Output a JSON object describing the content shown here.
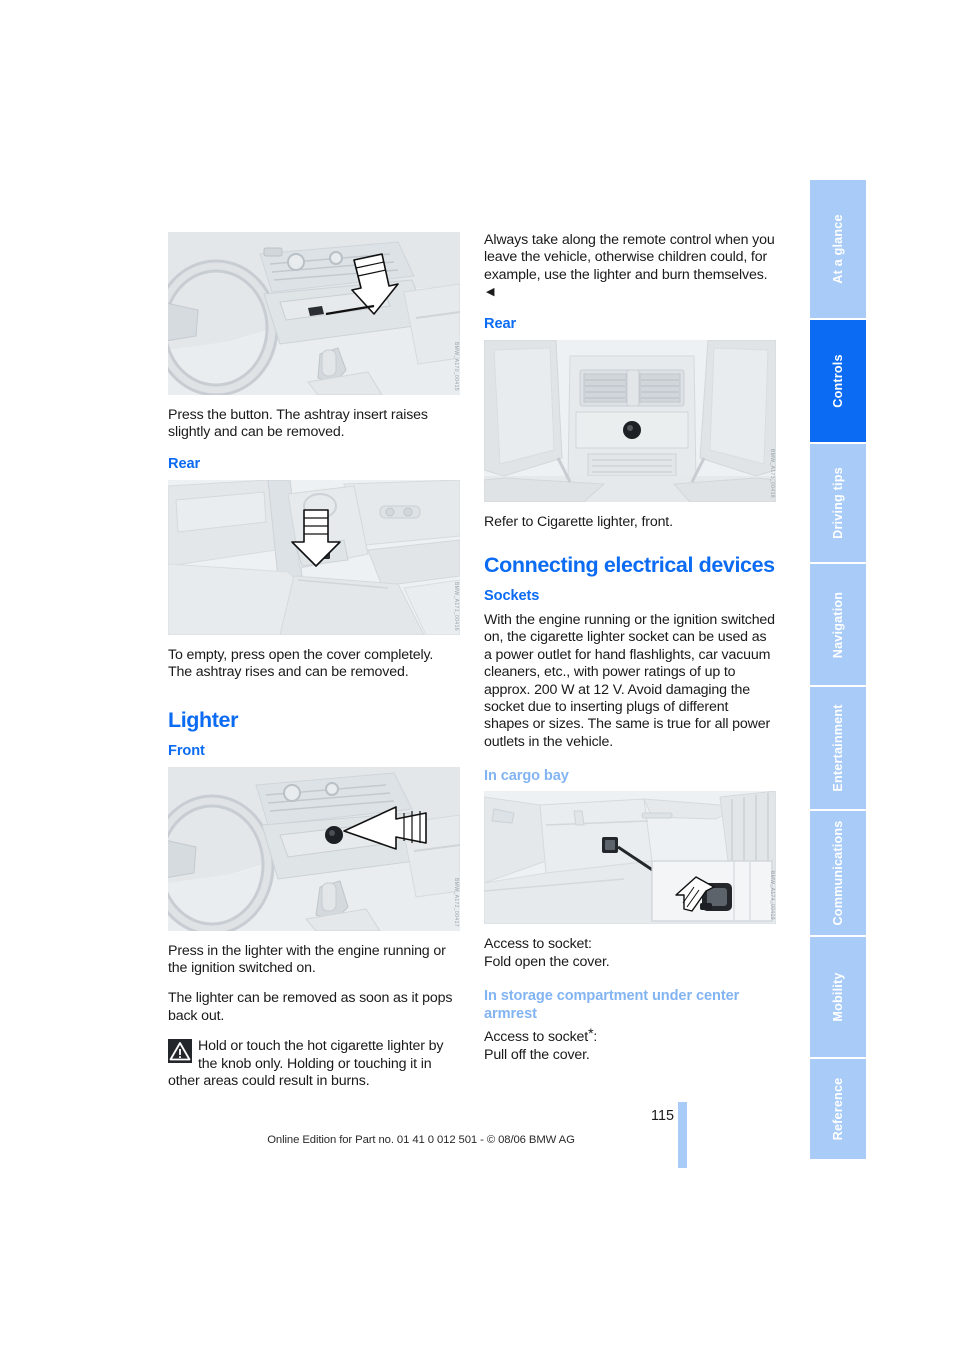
{
  "page": {
    "number": "115",
    "footer": "Online Edition for Part no. 01 41 0 012 501 - © 08/06 BMW AG"
  },
  "left_column": {
    "figure_ashtray_front": {
      "name": "front-ashtray-illustration",
      "code": "BMW_A170_00415"
    },
    "para_press_button": "Press the button. The ashtray insert raises slightly and can be removed.",
    "heading_rear": "Rear",
    "figure_ashtray_rear": {
      "name": "rear-ashtray-illustration",
      "code": "BMW_A171_00416"
    },
    "para_to_empty": "To empty, press open the cover completely. The ashtray rises and can be removed.",
    "heading_lighter": "Lighter",
    "heading_front": "Front",
    "figure_lighter_front": {
      "name": "front-lighter-illustration",
      "code": "BMW_A172_00417"
    },
    "para_press_in": "Press in the lighter with the engine running or the ignition switched on.",
    "para_pops_out": "The lighter can be removed as soon as it pops back out.",
    "warning": "Hold or touch the hot cigarette lighter by the knob only. Holding or touching it in other areas could result in burns.",
    "warning_icon": "warning-triangle-icon"
  },
  "right_column": {
    "para_remote_control": "Always take along the remote control when you leave the vehicle, otherwise children could, for example, use the lighter and burn themselves.",
    "end_marker": "◀",
    "heading_rear": "Rear",
    "figure_lighter_rear": {
      "name": "rear-lighter-illustration",
      "code": "BMW_A173_00418"
    },
    "para_refer": "Refer to Cigarette lighter, front.",
    "heading_connecting": "Connecting electrical devices",
    "heading_sockets": "Sockets",
    "para_sockets": "With the engine running or the ignition switched on, the cigarette lighter socket can be used as a power outlet for hand flashlights, car vacuum cleaners, etc., with power ratings of up to approx. 200 W at 12 V. Avoid damaging the socket due to inserting plugs of different shapes or sizes. The same is true for all power outlets in the vehicle.",
    "heading_cargo_bay": "In cargo bay",
    "figure_cargo_socket": {
      "name": "cargo-bay-socket-illustration",
      "code": "BMW_A174_00419"
    },
    "para_access_cargo_1": "Access to socket:",
    "para_access_cargo_2": "Fold open the cover.",
    "heading_armrest": "In storage compartment under center armrest",
    "para_access_armrest_1": "Access to socket",
    "para_access_armrest_star": "*",
    "para_access_armrest_colon": ":",
    "para_access_armrest_2": "Pull off the cover."
  },
  "sidebar": {
    "tabs": [
      {
        "label": "At a glance",
        "active": false
      },
      {
        "label": "Controls",
        "active": true
      },
      {
        "label": "Driving tips",
        "active": false
      },
      {
        "label": "Navigation",
        "active": false
      },
      {
        "label": "Entertainment",
        "active": false
      },
      {
        "label": "Communications",
        "active": false
      },
      {
        "label": "Mobility",
        "active": false
      },
      {
        "label": "Reference",
        "active": false
      }
    ]
  },
  "colors": {
    "accent_blue": "#0b6bf2",
    "light_blue": "#a8cbf7",
    "subheading_light_blue": "#83b4f2",
    "text": "#1a1a1a",
    "figure_bg": "#eef1f3"
  }
}
